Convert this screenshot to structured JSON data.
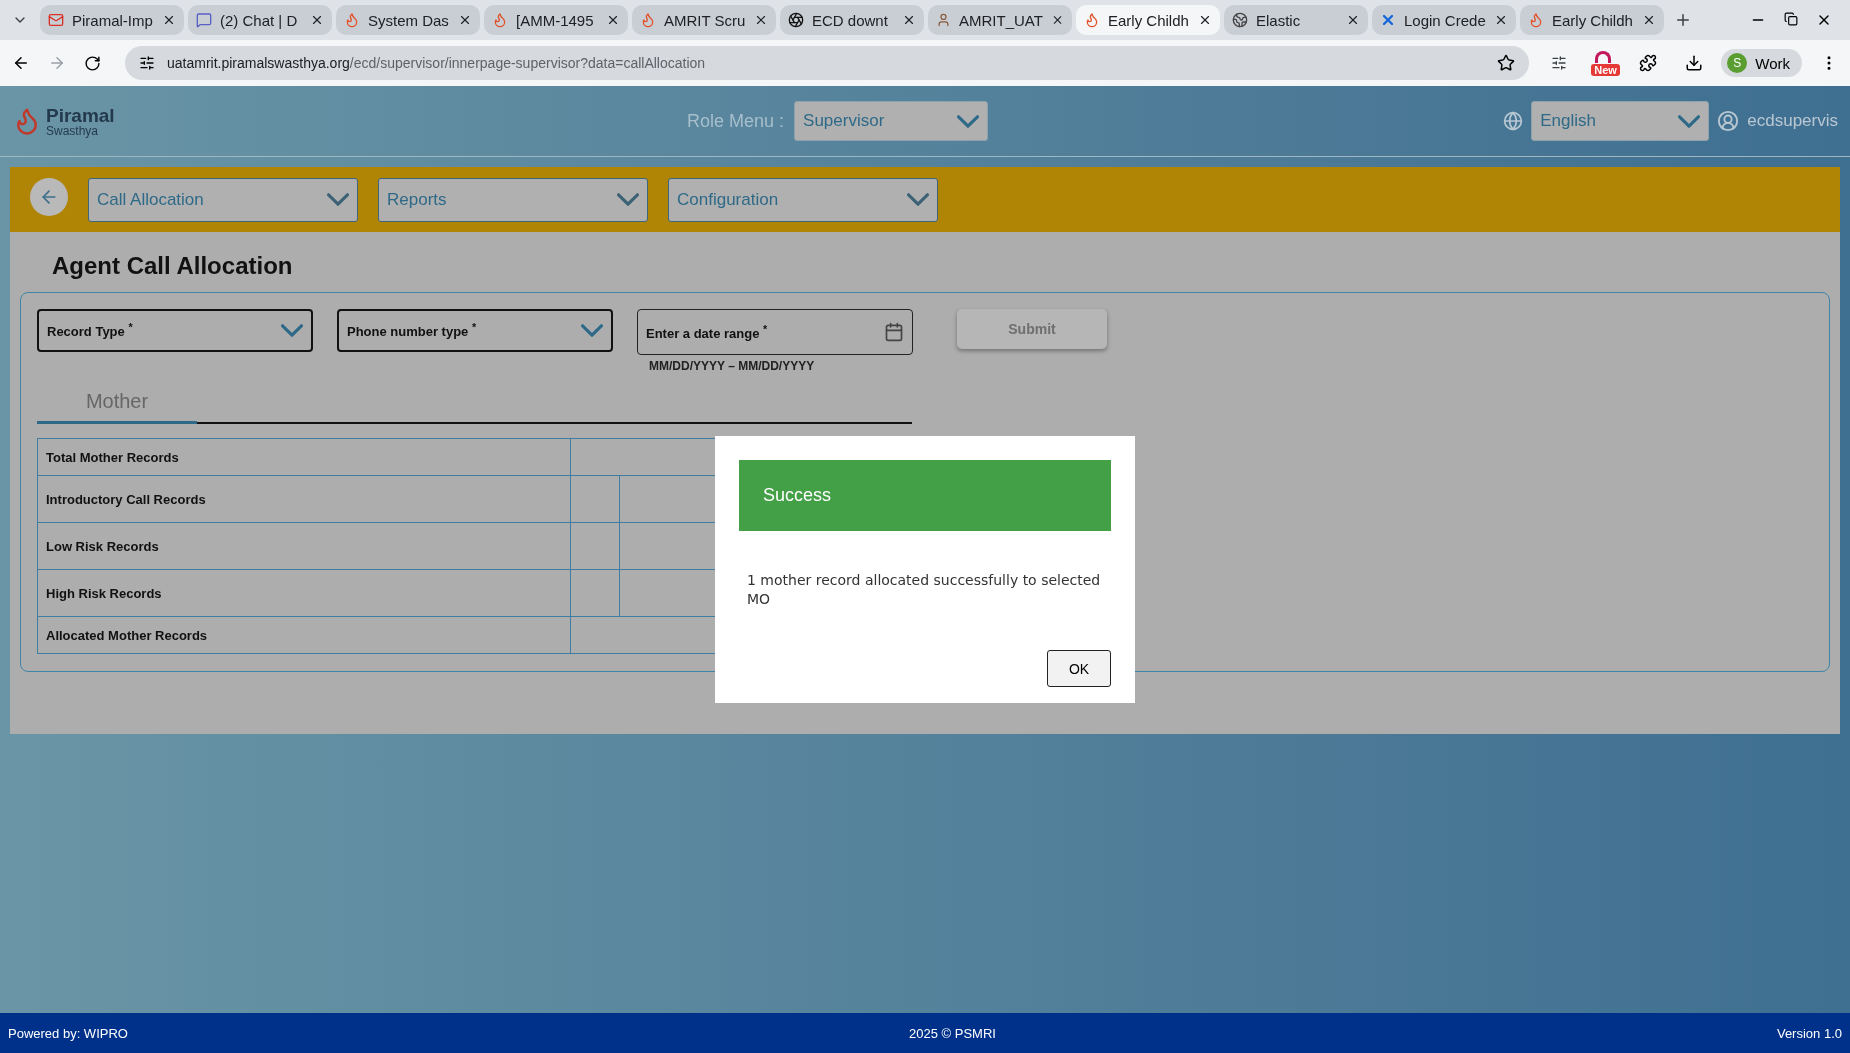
{
  "browser": {
    "tabs": [
      {
        "title": "Piramal-Imp",
        "kind": "mail",
        "selected": false
      },
      {
        "title": "(2) Chat | D",
        "kind": "chat",
        "selected": false
      },
      {
        "title": "System Das",
        "kind": "flame",
        "selected": false
      },
      {
        "title": "[AMM-1495",
        "kind": "flame",
        "selected": false
      },
      {
        "title": "AMRIT Scru",
        "kind": "flame",
        "selected": false
      },
      {
        "title": "ECD downt",
        "kind": "swirl",
        "selected": false
      },
      {
        "title": "AMRIT_UAT",
        "kind": "person",
        "selected": false
      },
      {
        "title": "Early Childh",
        "kind": "flame",
        "selected": true
      },
      {
        "title": "Elastic",
        "kind": "globe",
        "selected": false
      },
      {
        "title": "Login Crede",
        "kind": "cross",
        "selected": false
      },
      {
        "title": "Early Childh",
        "kind": "flame",
        "selected": false
      }
    ],
    "url_host": "uatamrit.piramalswasthya.org",
    "url_path": "/ecd/supervisor/innerpage-supervisor?data=callAllocation",
    "badge": "New",
    "profile_initial": "S",
    "profile": "Work"
  },
  "header": {
    "logo": "Piramal",
    "logo_sub": "Swasthya",
    "role_label": "Role Menu :",
    "role_value": "Supervisor",
    "language": "English",
    "user": "ecdsupervis"
  },
  "nav": {
    "menus": [
      "Call Allocation",
      "Reports",
      "Configuration"
    ]
  },
  "page": {
    "title": "Agent Call Allocation",
    "filters": [
      {
        "kind": "select",
        "label": "Record Type $^{*}$"
      },
      {
        "kind": "select",
        "label": "Phone number type $^{*}$"
      },
      {
        "kind": "date",
        "label": "Enter a date range $^{*}$",
        "hint": "MM/DD/YYYY – MM/DD/YYYY"
      }
    ],
    "submit": {
      "label": "Submit",
      "disabled": true
    },
    "tabs": [
      {
        "label": "Mother",
        "selected": true
      }
    ],
    "table": {
      "rows": [
        {
          "label": "Total Mother Records",
          "kind": "single"
        },
        {
          "label": "Introductory Call Records",
          "kind": "split"
        },
        {
          "label": "Low Risk Records",
          "kind": "split"
        },
        {
          "label": "High Risk Records",
          "kind": "split"
        },
        {
          "label": "Allocated Mother Records",
          "kind": "single"
        }
      ]
    }
  },
  "dialog": {
    "title": "Success",
    "message": "1 mother record allocated successfully to selected MO",
    "button": "OK"
  },
  "footer": {
    "left": "Powered by: WIPRO",
    "center": "2025 © PSMRI",
    "right": "Version 1.0"
  }
}
